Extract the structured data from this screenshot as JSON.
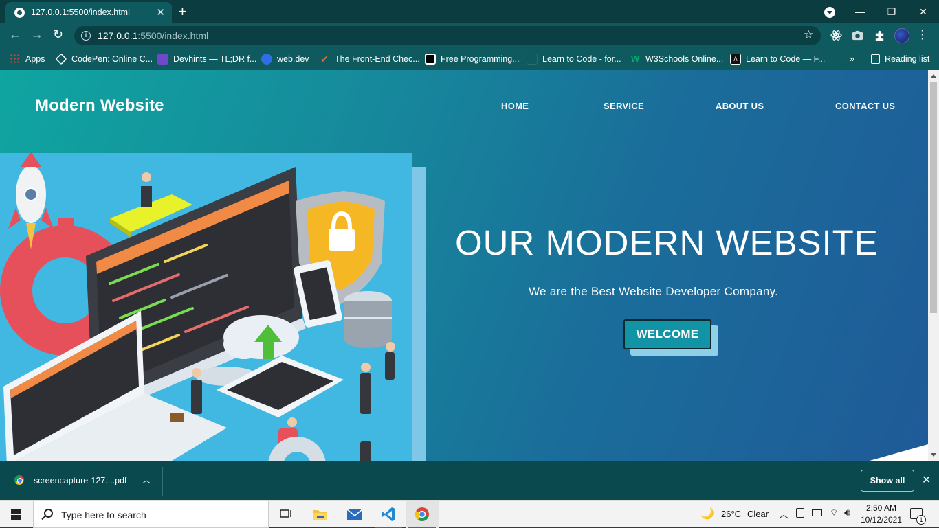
{
  "browser": {
    "tab_title": "127.0.0.1:5500/index.html",
    "url_host": "127.0.0.1",
    "url_rest": ":5500/index.html",
    "bookmarks": [
      {
        "label": "Apps",
        "color": "#e94235"
      },
      {
        "label": "CodePen: Online C...",
        "color": "#ffffff"
      },
      {
        "label": "Devhints — TL;DR f...",
        "color": "#6e49cb"
      },
      {
        "label": "web.dev",
        "color": "#2f6ee5"
      },
      {
        "label": "The Front-End Chec...",
        "color": "#e36b2c"
      },
      {
        "label": "Free Programming...",
        "color": "#000000"
      },
      {
        "label": "Learn to Code - for...",
        "color": "#1b3a3d"
      },
      {
        "label": "W3Schools Online...",
        "color": "#04aa6d"
      },
      {
        "label": "Learn to Code — F...",
        "color": "#111111"
      }
    ],
    "reading_list": "Reading list",
    "more_bookmarks": "»"
  },
  "page": {
    "logo": "Modern Website",
    "nav": [
      "HOME",
      "SERVICE",
      "ABOUT US",
      "CONTACT US"
    ],
    "hero_title": "OUR MODERN WEBSITE",
    "hero_subtitle": "We are the Best Website Developer Company.",
    "cta_label": "WELCOME",
    "colors": {
      "gradient_start": "#0fa5a0",
      "gradient_end": "#1f5a98",
      "illustration_bg": "#41b8e2",
      "cta": "#1393a6"
    }
  },
  "downloads": {
    "file_name": "screencapture-127....pdf",
    "show_all": "Show all"
  },
  "taskbar": {
    "search_placeholder": "Type here to search",
    "weather_temp": "26°C",
    "weather_desc": "Clear",
    "time": "2:50 AM",
    "date": "10/12/2021",
    "notification_count": "1"
  }
}
